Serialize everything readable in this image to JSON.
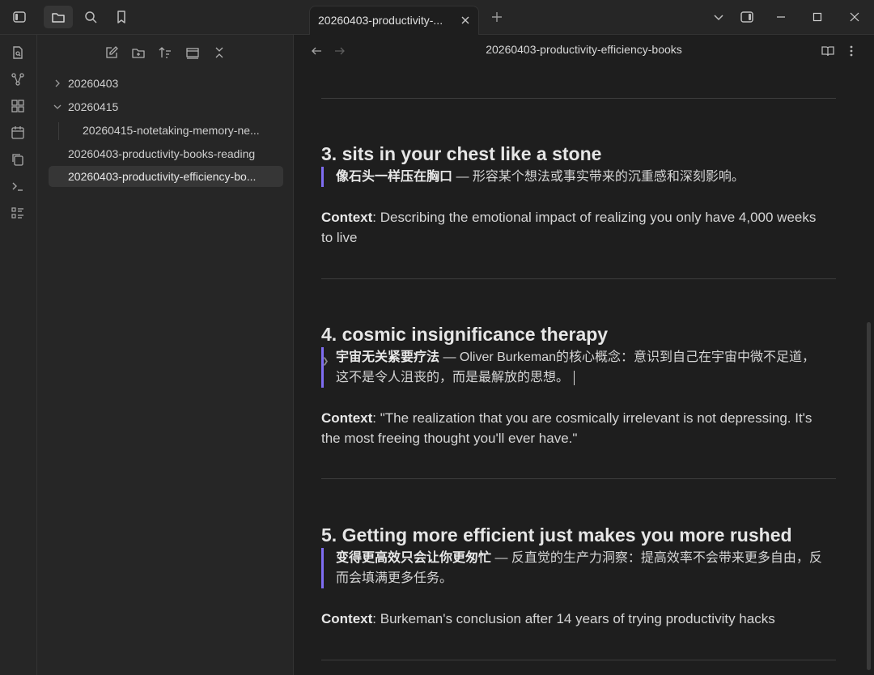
{
  "tab": {
    "title": "20260403-productivity-..."
  },
  "file_tree": {
    "items": [
      {
        "label": "20260403",
        "type": "folder",
        "expanded": false
      },
      {
        "label": "20260415",
        "type": "folder",
        "expanded": true
      },
      {
        "label": "20260415-notetaking-memory-ne...",
        "type": "file"
      },
      {
        "label": "20260403-productivity-books-reading",
        "type": "file"
      },
      {
        "label": "20260403-productivity-efficiency-bo...",
        "type": "file",
        "active": true
      }
    ]
  },
  "editor": {
    "title": "20260403-productivity-efficiency-books",
    "sections": [
      {
        "heading": "3. sits in your chest like a stone",
        "quote_bold": "像石头一样压在胸口",
        "quote_rest": " — 形容某个想法或事实带来的沉重感和深刻影响。",
        "context_label": "Context",
        "context_text": ": Describing the emotional impact of realizing you only have 4,000 weeks to live"
      },
      {
        "heading": "4. cosmic insignificance therapy",
        "quote_bold": "宇宙无关紧要疗法",
        "quote_rest": " — Oliver Burkeman的核心概念：意识到自己在宇宙中微不足道，这不是令人沮丧的，而是最解放的思想。",
        "context_label": "Context",
        "context_text": ": \"The realization that you are cosmically irrelevant is not depressing. It's the most freeing thought you'll ever have.\""
      },
      {
        "heading": "5. Getting more efficient just makes you more rushed",
        "quote_bold": "变得更高效只会让你更匆忙",
        "quote_rest": " — 反直觉的生产力洞察：提高效率不会带来更多自由，反而会填满更多任务。",
        "context_label": "Context",
        "context_text": ": Burkeman's conclusion after 14 years of trying productivity hacks"
      }
    ]
  },
  "colors": {
    "accent": "#7f6df2",
    "bg": "#1e1e1e",
    "panel": "#262626"
  }
}
